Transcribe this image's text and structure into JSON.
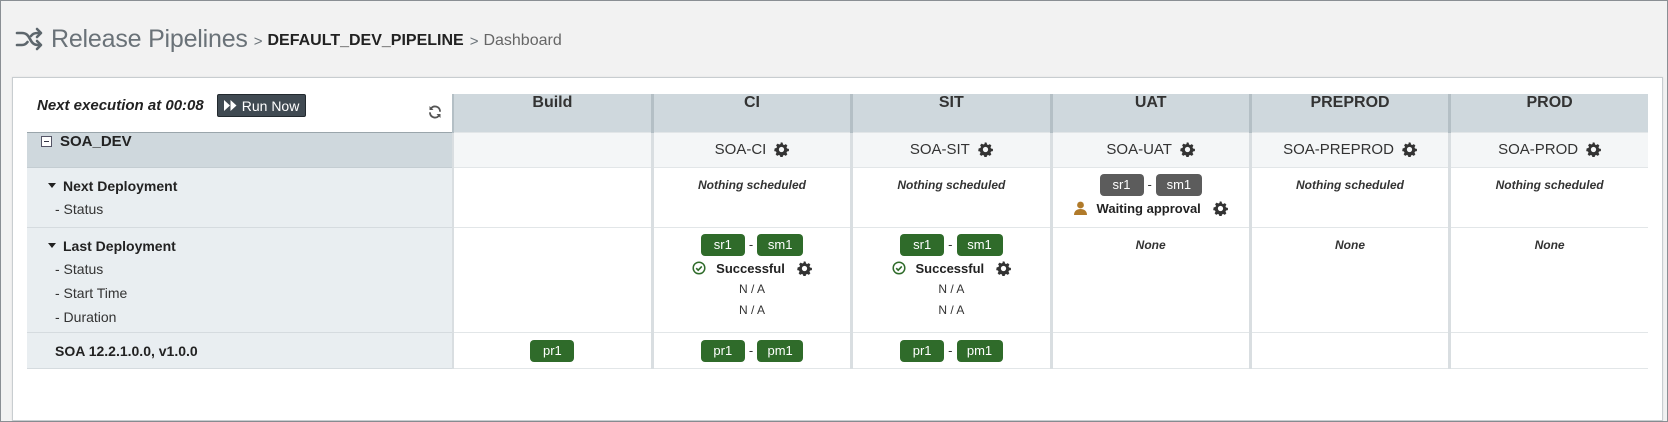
{
  "breadcrumb": {
    "root": "Release Pipelines",
    "sep1": ">",
    "pipeline": "DEFAULT_DEV_PIPELINE",
    "sep2": ">",
    "page": "Dashboard"
  },
  "controls": {
    "next_execution": "Next execution at 00:08",
    "run_now": "Run Now"
  },
  "stages": [
    "Build",
    "CI",
    "SIT",
    "UAT",
    "PREPROD",
    "PROD"
  ],
  "pipeline": {
    "name": "SOA_DEV",
    "stage_names": [
      "",
      "SOA-CI",
      "SOA-SIT",
      "SOA-UAT",
      "SOA-PREPROD",
      "SOA-PROD"
    ]
  },
  "next_deployment": {
    "title": "Next Deployment",
    "status_label": "- Status",
    "nothing": "Nothing scheduled",
    "uat": {
      "badge1": "sr1",
      "badge2": "sm1",
      "dash": "-",
      "status": "Waiting approval"
    }
  },
  "last_deployment": {
    "title": "Last Deployment",
    "status_label": "- Status",
    "start_label": "- Start Time",
    "duration_label": "- Duration",
    "none": "None",
    "ci": {
      "badge1": "sr1",
      "badge2": "sm1",
      "dash": "-",
      "status": "Successful",
      "start": "N / A",
      "duration": "N / A"
    },
    "sit": {
      "badge1": "sr1",
      "badge2": "sm1",
      "dash": "-",
      "status": "Successful",
      "start": "N / A",
      "duration": "N / A"
    }
  },
  "version_row": {
    "label": "SOA 12.2.1.0.0, v1.0.0",
    "build": "pr1",
    "ci": {
      "badge1": "pr1",
      "badge2": "pm1",
      "dash": "-"
    },
    "sit": {
      "badge1": "pr1",
      "badge2": "pm1",
      "dash": "-"
    }
  },
  "colors": {
    "badge_green": "#2f6b2a",
    "badge_dark": "#5c5c5c",
    "header_bg": "#cfd8dd",
    "row_label_bg": "#e9eef1",
    "approval_user": "#b07a2a"
  },
  "icons": {
    "breadcrumb": "shuffle-icon",
    "run": "fast-forward-icon",
    "refresh": "refresh-icon",
    "settings": "gear-icon",
    "success": "check-circle-icon",
    "approval": "user-icon",
    "collapse": "collapse-square-icon",
    "expand": "caret-down-icon"
  }
}
